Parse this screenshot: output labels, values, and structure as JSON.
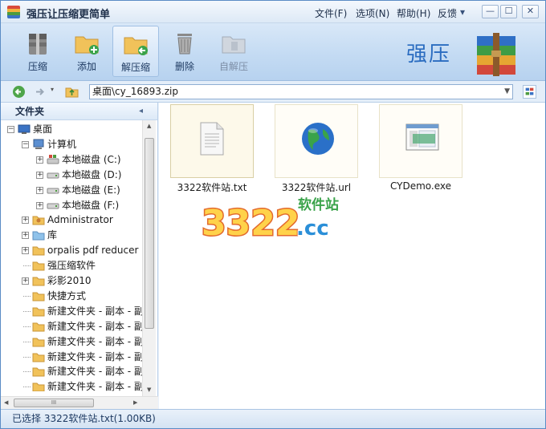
{
  "window": {
    "title": "强压让压缩更简单",
    "menu": [
      "文件(F)",
      "选项(N)",
      "帮助(H)",
      "反馈"
    ],
    "controls": {
      "minimize": "—",
      "maximize": "☐",
      "close": "✕"
    }
  },
  "toolbar": {
    "buttons": [
      {
        "label": "压缩",
        "icon": "compress-icon",
        "active": false,
        "enabled": true
      },
      {
        "label": "添加",
        "icon": "add-icon",
        "active": false,
        "enabled": true
      },
      {
        "label": "解压缩",
        "icon": "extract-icon",
        "active": true,
        "enabled": true
      },
      {
        "label": "删除",
        "icon": "delete-icon",
        "active": false,
        "enabled": true
      },
      {
        "label": "自解压",
        "icon": "sfx-icon",
        "active": false,
        "enabled": false
      }
    ],
    "brand": "强压"
  },
  "address": {
    "path": "桌面\\cy_16893.zip"
  },
  "sidebar": {
    "title": "文件夹",
    "tree": [
      {
        "label": "桌面",
        "level": 0,
        "expander": "-",
        "icon": "desktop-icon"
      },
      {
        "label": "计算机",
        "level": 1,
        "expander": "-",
        "icon": "computer-icon"
      },
      {
        "label": "本地磁盘 (C:)",
        "level": 2,
        "expander": "+",
        "icon": "system-drive-icon"
      },
      {
        "label": "本地磁盘 (D:)",
        "level": 2,
        "expander": "+",
        "icon": "drive-icon"
      },
      {
        "label": "本地磁盘 (E:)",
        "level": 2,
        "expander": "+",
        "icon": "drive-icon"
      },
      {
        "label": "本地磁盘 (F:)",
        "level": 2,
        "expander": "+",
        "icon": "drive-icon"
      },
      {
        "label": "Administrator",
        "level": 1,
        "expander": "+",
        "icon": "user-folder-icon"
      },
      {
        "label": "库",
        "level": 1,
        "expander": "+",
        "icon": "library-icon"
      },
      {
        "label": "orpalis pdf reducer",
        "level": 1,
        "expander": "+",
        "icon": "folder-icon"
      },
      {
        "label": "强压缩软件",
        "level": 1,
        "expander": "",
        "icon": "folder-icon"
      },
      {
        "label": "彩影2010",
        "level": 1,
        "expander": "+",
        "icon": "folder-icon"
      },
      {
        "label": "快捷方式",
        "level": 1,
        "expander": "",
        "icon": "folder-icon"
      },
      {
        "label": "新建文件夹 - 副本 - 副:",
        "level": 1,
        "expander": "",
        "icon": "folder-icon"
      },
      {
        "label": "新建文件夹 - 副本 - 副:",
        "level": 1,
        "expander": "",
        "icon": "folder-icon"
      },
      {
        "label": "新建文件夹 - 副本 - 副:",
        "level": 1,
        "expander": "",
        "icon": "folder-icon"
      },
      {
        "label": "新建文件夹 - 副本 - 副:",
        "level": 1,
        "expander": "",
        "icon": "folder-icon"
      },
      {
        "label": "新建文件夹 - 副本 - 副:",
        "level": 1,
        "expander": "",
        "icon": "folder-icon"
      },
      {
        "label": "新建文件夹 - 副本 - 副:",
        "level": 1,
        "expander": "",
        "icon": "folder-icon"
      }
    ],
    "hscroll_grip": "III"
  },
  "files": [
    {
      "name": "3322软件站.txt",
      "icon": "text-file-icon",
      "selected": true
    },
    {
      "name": "3322软件站.url",
      "icon": "globe-icon",
      "selected": false
    },
    {
      "name": "CYDemo.exe",
      "icon": "exe-icon",
      "selected": false
    }
  ],
  "watermark": {
    "number": "3322",
    "suffix": ".cc",
    "tagline": "软件站"
  },
  "status": {
    "text": "已选择 3322软件站.txt(1.00KB)"
  }
}
